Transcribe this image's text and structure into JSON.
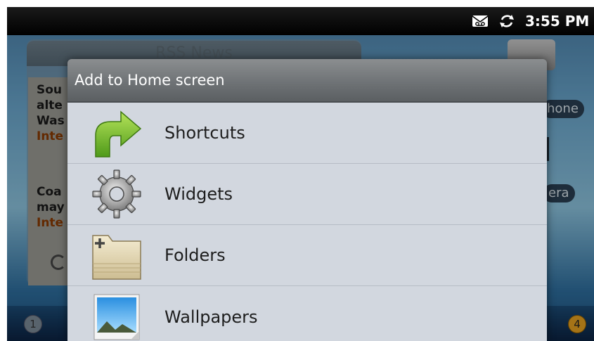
{
  "status_bar": {
    "time": "3:55 PM",
    "icons": [
      "voicemail-icon",
      "sync-icon"
    ]
  },
  "background": {
    "widget_title": "RSS News",
    "article_lines": [
      "Sou",
      "alte",
      "Was",
      "Inte",
      "Coa",
      "may",
      "Inte"
    ],
    "right_pills": [
      "hone",
      "era"
    ],
    "page_indicators": [
      "1",
      "4"
    ]
  },
  "dialog": {
    "title": "Add to Home screen",
    "items": [
      {
        "label": "Shortcuts",
        "icon": "shortcut-arrow-icon"
      },
      {
        "label": "Widgets",
        "icon": "gear-icon"
      },
      {
        "label": "Folders",
        "icon": "folder-icon"
      },
      {
        "label": "Wallpapers",
        "icon": "wallpaper-icon"
      }
    ]
  }
}
